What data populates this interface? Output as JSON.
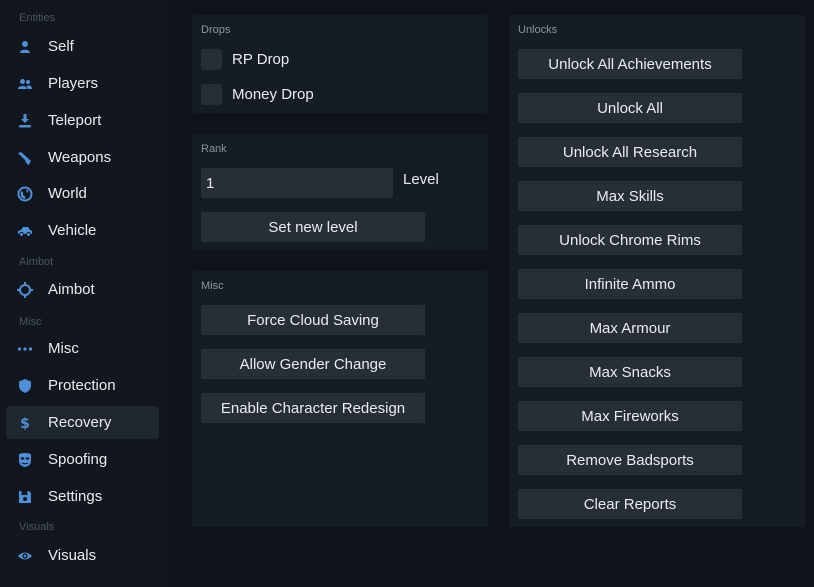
{
  "sidebar": {
    "sections": {
      "entities": "Entities",
      "aimbot": "Aimbot",
      "misc": "Misc",
      "visuals": "Visuals"
    },
    "items": [
      {
        "label": "Self",
        "icon": "person-icon"
      },
      {
        "label": "Players",
        "icon": "people-icon"
      },
      {
        "label": "Teleport",
        "icon": "teleport-icon"
      },
      {
        "label": "Weapons",
        "icon": "gun-icon"
      },
      {
        "label": "World",
        "icon": "globe-icon"
      },
      {
        "label": "Vehicle",
        "icon": "car-icon"
      },
      {
        "label": "Aimbot",
        "icon": "crosshair-icon"
      },
      {
        "label": "Misc",
        "icon": "dots-icon"
      },
      {
        "label": "Protection",
        "icon": "shield-icon"
      },
      {
        "label": "Recovery",
        "icon": "dollar-icon",
        "active": true
      },
      {
        "label": "Spoofing",
        "icon": "mask-icon"
      },
      {
        "label": "Settings",
        "icon": "save-icon"
      },
      {
        "label": "Visuals",
        "icon": "eye-icon"
      }
    ]
  },
  "drops": {
    "title": "Drops",
    "rp_drop": "RP Drop",
    "money_drop": "Money Drop"
  },
  "rank": {
    "title": "Rank",
    "level_value": "1",
    "level_label": "Level",
    "set_button": "Set new level"
  },
  "misc": {
    "title": "Misc",
    "buttons": [
      "Force Cloud Saving",
      "Allow Gender Change",
      "Enable Character Redesign"
    ]
  },
  "unlocks": {
    "title": "Unlocks",
    "buttons": [
      "Unlock All Achievements",
      "Unlock All",
      "Unlock All Research",
      "Max Skills",
      "Unlock Chrome Rims",
      "Infinite Ammo",
      "Max Armour",
      "Max Snacks",
      "Max Fireworks",
      "Remove Badsports",
      "Clear Reports"
    ]
  },
  "colors": {
    "accent": "#4d8fd9",
    "background": "#0f141a",
    "panel": "#161c23",
    "button": "#272e37"
  }
}
